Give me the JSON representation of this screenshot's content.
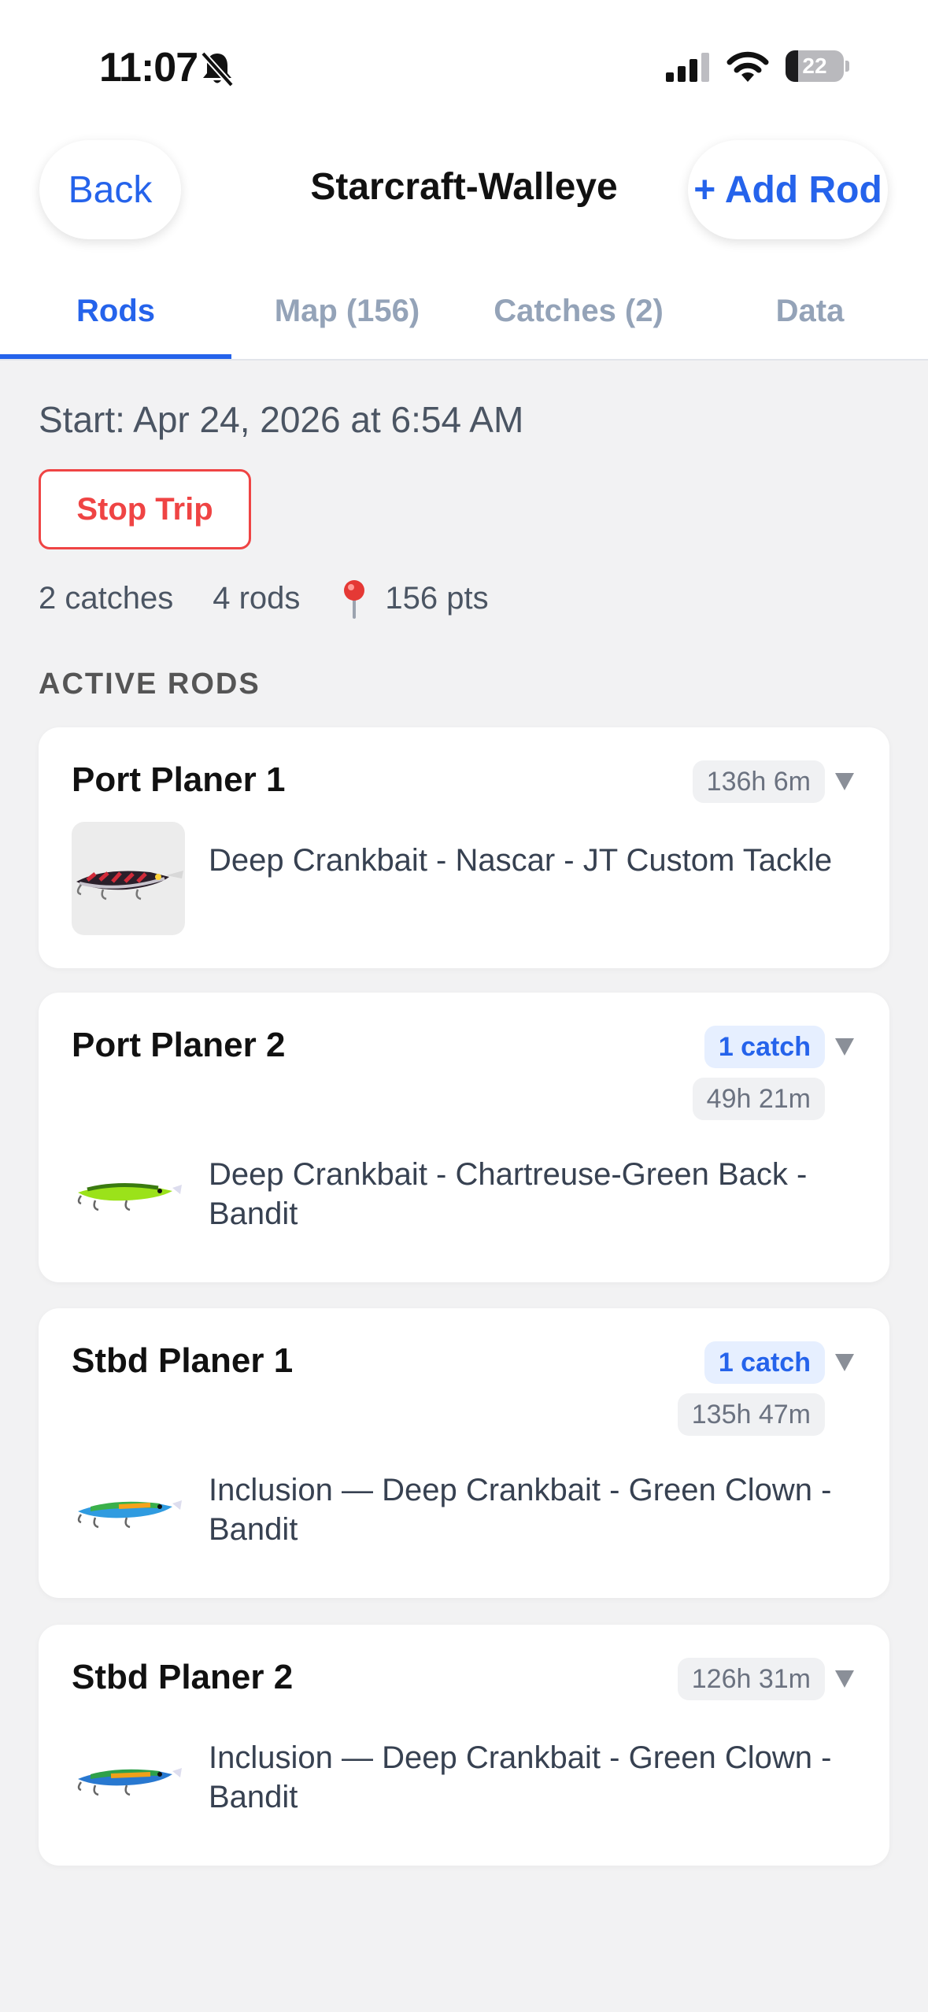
{
  "status_bar": {
    "time": "11:07",
    "battery": "22",
    "battery_level": 0.22
  },
  "header": {
    "back_label": "Back",
    "title": "Starcraft-Walleye",
    "add_label": "+ Add Rod"
  },
  "tabs": [
    {
      "label": "Rods",
      "active": true
    },
    {
      "label": "Map (156)",
      "active": false
    },
    {
      "label": "Catches (2)",
      "active": false
    },
    {
      "label": "Data",
      "active": false
    }
  ],
  "trip": {
    "start": "Start: Apr 24, 2026 at 6:54 AM",
    "stop_label": "Stop Trip",
    "catches": "2 catches",
    "rods": "4 rods",
    "points": "156 pts"
  },
  "section_label": "ACTIVE RODS",
  "rods": [
    {
      "name": "Port Planer 1",
      "duration": "136h 6m",
      "catch": "",
      "lure": "Deep Crankbait - Nascar - JT Custom Tackle"
    },
    {
      "name": "Port Planer 2",
      "duration": "49h 21m",
      "catch": "1 catch",
      "lure": "Deep Crankbait - Chartreuse-Green Back - Bandit"
    },
    {
      "name": "Stbd Planer 1",
      "duration": "135h 47m",
      "catch": "1 catch",
      "lure": "Inclusion — Deep Crankbait - Green Clown - Bandit"
    },
    {
      "name": "Stbd Planer 2",
      "duration": "126h 31m",
      "catch": "",
      "lure": "Inclusion — Deep Crankbait - Green Clown - Bandit"
    }
  ],
  "icons": {
    "bell": "bell-slash-icon",
    "signal": "cellular-signal-icon",
    "wifi": "wifi-icon",
    "battery": "battery-icon",
    "pin": "map-pin-icon",
    "chevron": "chevron-down-icon"
  },
  "colors": {
    "accent": "#2563eb",
    "danger": "#ef4444",
    "pin": "#e53935"
  }
}
